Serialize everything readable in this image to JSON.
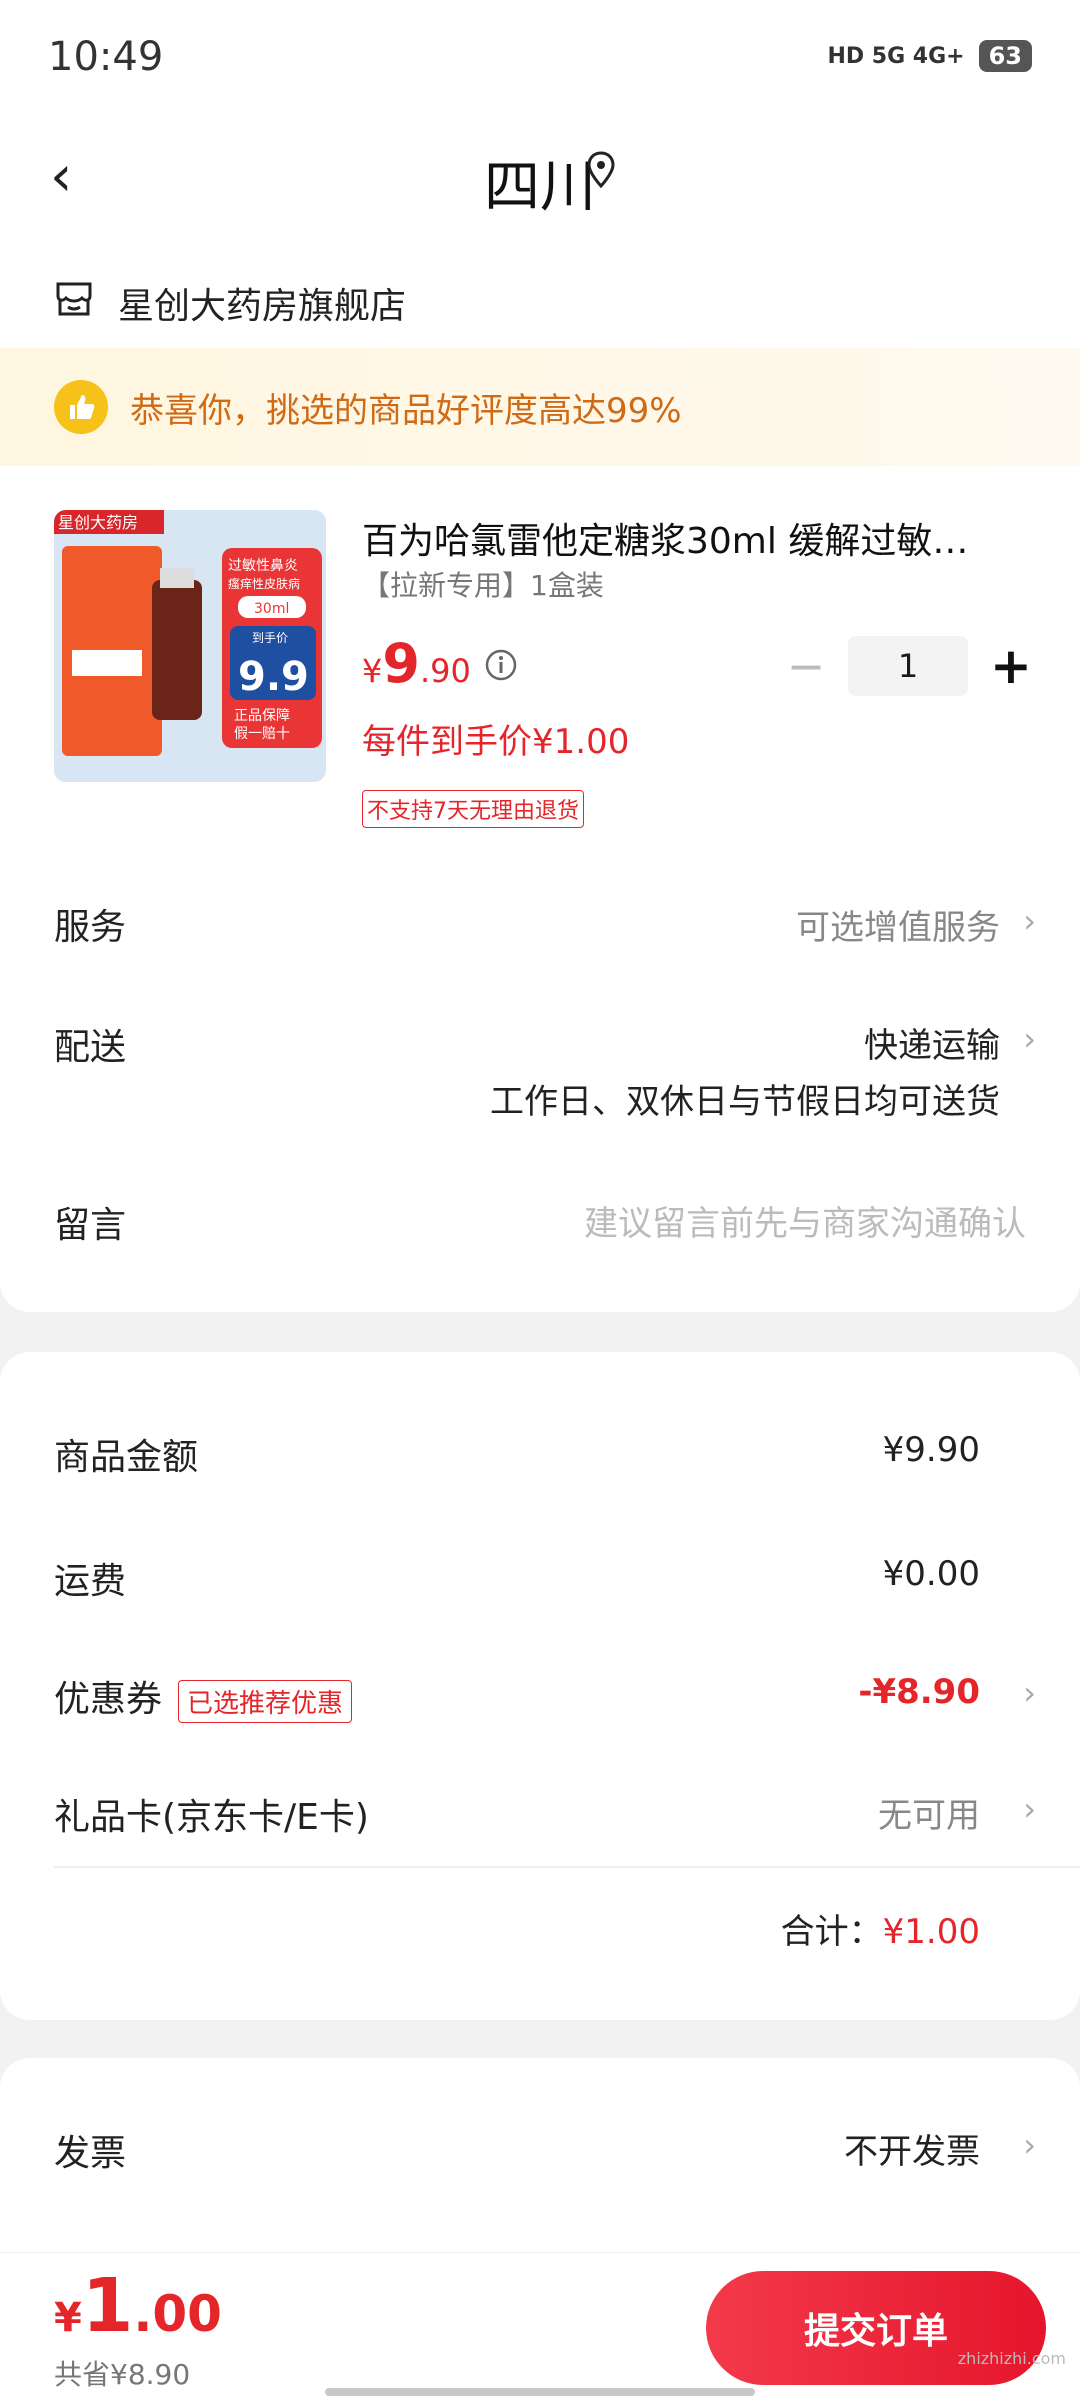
{
  "status_bar": {
    "time": "10:49",
    "network": "HD 5G 4G+",
    "battery": "63"
  },
  "header": {
    "title": "四川"
  },
  "store": {
    "name": "星创大药房旗舰店"
  },
  "banner": {
    "text": "恭喜你，挑选的商品好评度高达99%"
  },
  "product": {
    "image_brand": "星创大药房",
    "image_tags": [
      "过敏性鼻炎",
      "瘙痒性皮肤病",
      "30ml",
      "到手价",
      "9.9",
      "正品保障",
      "假一赔十"
    ],
    "name": "百为哈氯雷他定糖浆30ml 缓解过敏…",
    "spec": "【拉新专用】1盒装",
    "price_currency": "¥",
    "price_int": "9",
    "price_dec": ".90",
    "quantity": "1",
    "final_price": "每件到手价¥1.00",
    "return_policy": "不支持7天无理由退货"
  },
  "rows": {
    "service": {
      "label": "服务",
      "value": "可选增值服务"
    },
    "delivery": {
      "label": "配送",
      "value": "快递运输",
      "note": "工作日、双休日与节假日均可送货"
    },
    "message": {
      "label": "留言",
      "placeholder": "建议留言前先与商家沟通确认"
    }
  },
  "summary": {
    "goods_amount": {
      "label": "商品金额",
      "value": "¥9.90"
    },
    "shipping": {
      "label": "运费",
      "value": "¥0.00"
    },
    "coupon": {
      "label": "优惠券",
      "badge": "已选推荐优惠",
      "value": "-¥8.90"
    },
    "gift_card": {
      "label": "礼品卡(京东卡/E卡)",
      "value": "无可用"
    },
    "total_label": "合计：",
    "total_value": "¥1.00"
  },
  "invoice": {
    "label": "发票",
    "value": "不开发票"
  },
  "bottom": {
    "currency": "¥",
    "total_int": "1",
    "total_dec": ".00",
    "saved": "共省¥8.90",
    "submit_label": "提交订单",
    "watermark": "zhizhizhi.com"
  },
  "colors": {
    "accent": "#e4262b",
    "banner_text": "#cf6a16"
  }
}
